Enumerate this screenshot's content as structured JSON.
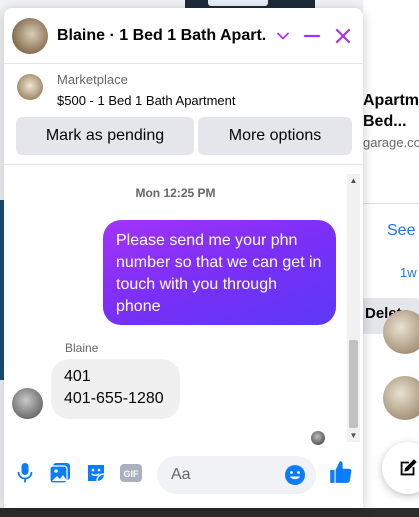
{
  "background": {
    "listing_title": "Apartment-\nBed...",
    "listing_domain": "garage.com",
    "see_link": "See",
    "time_ago": "1w",
    "delete_label": "Delete"
  },
  "chat": {
    "title": "Blaine · 1 Bed 1 Bath Apart...",
    "listing": {
      "source": "Marketplace",
      "title": "$500 - 1 Bed 1 Bath Apartment",
      "pending_button": "Mark as pending",
      "more_button": "More options"
    },
    "messages": {
      "timestamp": "Mon 12:25 PM",
      "outgoing": "Please send me your phn number so that we can get in touch with you through phone",
      "sender_name": "Blaine",
      "incoming_line1": "401",
      "incoming_line2": "401-655-1280"
    },
    "composer": {
      "placeholder": "Aa"
    }
  },
  "colors": {
    "accent": "#a334fa",
    "bubble_gradient_end": "#5b39f4",
    "icon_blue": "#0a7cff"
  },
  "icons": [
    "chevron-down-icon",
    "minimize-icon",
    "close-icon",
    "microphone-icon",
    "photo-icon",
    "sticker-icon",
    "gif-icon",
    "emoji-icon",
    "thumbs-up-icon",
    "compose-icon"
  ]
}
